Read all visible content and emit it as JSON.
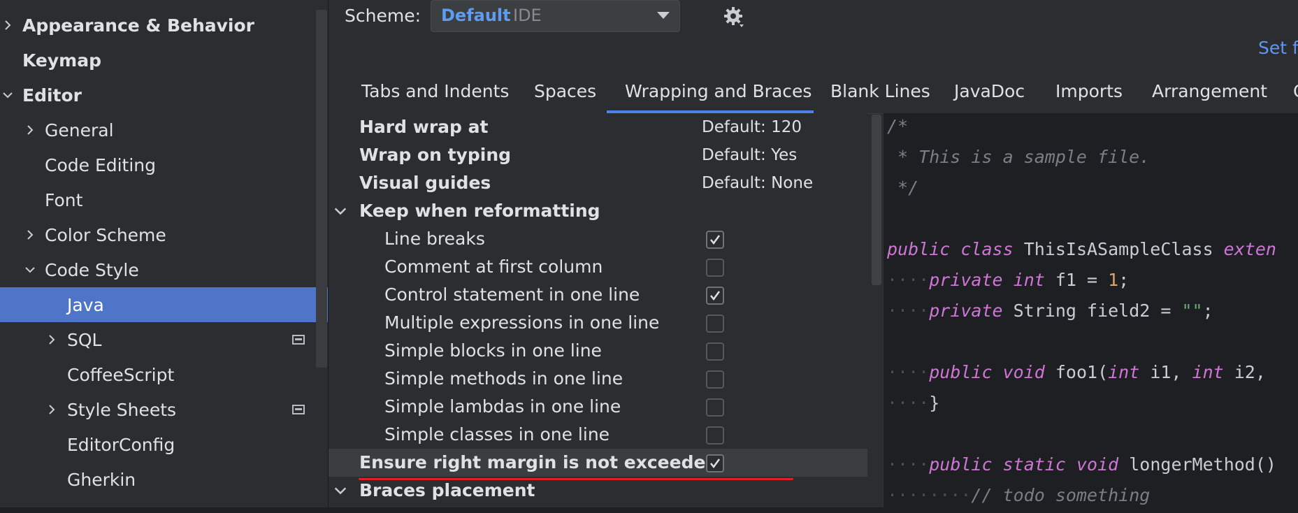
{
  "sidebar": {
    "items": [
      {
        "label": "Appearance & Behavior"
      },
      {
        "label": "Keymap"
      },
      {
        "label": "Editor"
      },
      {
        "label": "General"
      },
      {
        "label": "Code Editing"
      },
      {
        "label": "Font"
      },
      {
        "label": "Color Scheme"
      },
      {
        "label": "Code Style"
      },
      {
        "label": "Java"
      },
      {
        "label": "SQL"
      },
      {
        "label": "CoffeeScript"
      },
      {
        "label": "Style Sheets"
      },
      {
        "label": "EditorConfig"
      },
      {
        "label": "Gherkin"
      }
    ]
  },
  "scheme": {
    "label": "Scheme:",
    "value": "Default",
    "sub": "IDE"
  },
  "set_from": "Set fr",
  "tabs": [
    "Tabs and Indents",
    "Spaces",
    "Wrapping and Braces",
    "Blank Lines",
    "JavaDoc",
    "Imports",
    "Arrangement",
    "C"
  ],
  "settings": [
    {
      "label": "Hard wrap at",
      "value": "Default: 120"
    },
    {
      "label": "Wrap on typing",
      "value": "Default: Yes"
    },
    {
      "label": "Visual guides",
      "value": "Default: None"
    },
    {
      "label": "Keep when reformatting"
    },
    {
      "label": "Line breaks",
      "checked": true
    },
    {
      "label": "Comment at first column",
      "checked": false
    },
    {
      "label": "Control statement in one line",
      "checked": true
    },
    {
      "label": "Multiple expressions in one line",
      "checked": false
    },
    {
      "label": "Simple blocks in one line",
      "checked": false
    },
    {
      "label": "Simple methods in one line",
      "checked": false
    },
    {
      "label": "Simple lambdas in one line",
      "checked": false
    },
    {
      "label": "Simple classes in one line",
      "checked": false
    },
    {
      "label": "Ensure right margin is not exceeded",
      "checked": true
    },
    {
      "label": "Braces placement"
    }
  ],
  "code": {
    "l1": "/*",
    "l2": " * This is a sample file.",
    "l3": " */",
    "l5_kw1": "public",
    "l5_kw2": "class",
    "l5_name": " ThisIsASampleClass ",
    "l5_kw3": "exten",
    "l6_ws": "····",
    "l6_kw1": "private",
    "l6_kw2": "int",
    "l6_rest": " f1 = ",
    "l6_num": "1",
    "l6_end": ";",
    "l7_ws": "····",
    "l7_kw1": "private",
    "l7_rest": " String field2 = ",
    "l7_str": "\"\"",
    "l7_end": ";",
    "l9_ws": "····",
    "l9_kw1": "public",
    "l9_kw2": "void",
    "l9_rest1": " foo1(",
    "l9_kw3": "int",
    "l9_rest2": " i1, ",
    "l9_kw4": "int",
    "l9_rest3": " i2,",
    "l10_ws": "····",
    "l10_rest": "}",
    "l12_ws": "····",
    "l12_kw1": "public",
    "l12_kw2": "static",
    "l12_kw3": "void",
    "l12_rest": " longerMethod()",
    "l13_ws": "········",
    "l13_comment": "// todo something"
  },
  "colors": {
    "accent": "#4c82e6",
    "selection": "#4f75c9",
    "highlight_underline": "#e01e28"
  }
}
